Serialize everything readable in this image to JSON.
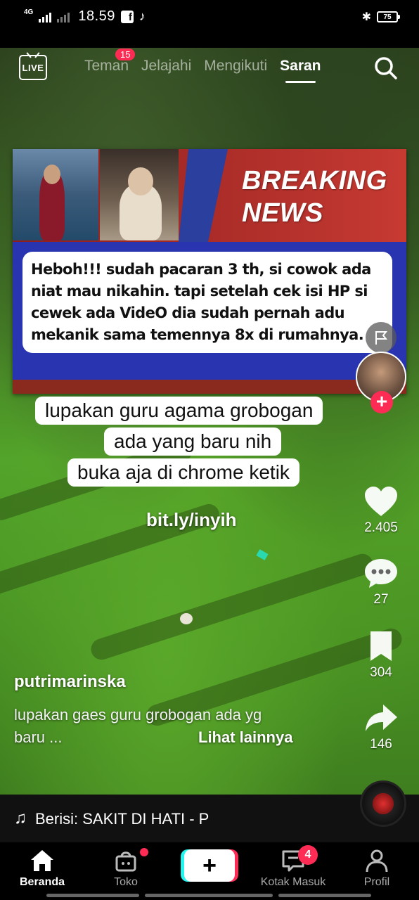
{
  "status_bar": {
    "network": "4G",
    "time": "18.59",
    "battery": "75"
  },
  "top_nav": {
    "live_label": "LIVE",
    "tabs": [
      {
        "label": "Teman",
        "badge": "15"
      },
      {
        "label": "Jelajahi"
      },
      {
        "label": "Mengikuti"
      },
      {
        "label": "Saran",
        "active": true
      }
    ]
  },
  "video": {
    "news_card": {
      "headline_line1": "BREAKING",
      "headline_line2": "NEWS",
      "text": "Heboh!!! sudah pacaran 3 th, si cowok ada niat mau nikahin. tapi setelah cek isi HP si cewek ada VideO dia sudah pernah adu mekanik sama temennya 8x di rumahnya."
    },
    "captions": [
      "lupakan guru agama grobogan",
      "ada yang baru nih",
      "buka aja di  chrome ketik"
    ],
    "link_text": "bit.ly/inyih"
  },
  "actions": {
    "likes": "2.405",
    "comments": "27",
    "bookmarks": "304",
    "shares": "146"
  },
  "post": {
    "username": "putrimarinska",
    "description_line1": "lupakan gaes guru grobogan ada yg",
    "description_line2": "baru ...",
    "see_more": "Lihat lainnya"
  },
  "music": {
    "label": "Berisi: SAKIT DI HATI - P"
  },
  "bottom_nav": {
    "items": [
      {
        "label": "Beranda",
        "active": true
      },
      {
        "label": "Toko"
      },
      {
        "label": ""
      },
      {
        "label": "Kotak Masuk",
        "badge": "4"
      },
      {
        "label": "Profil"
      }
    ]
  },
  "colors": {
    "accent_red": "#fe2c55",
    "accent_cyan": "#25f4ee",
    "news_blue": "#2834b0",
    "news_red": "#b82a2a"
  }
}
